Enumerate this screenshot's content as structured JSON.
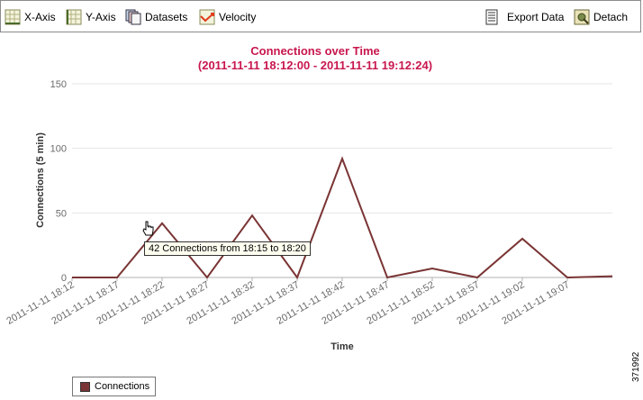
{
  "toolbar": {
    "x_axis_label": "X-Axis",
    "y_axis_label": "Y-Axis",
    "datasets_label": "Datasets",
    "velocity_label": "Velocity",
    "export_label": "Export Data",
    "detach_label": "Detach"
  },
  "tooltip": {
    "text": "42 Connections from 18:15 to 18:20"
  },
  "side_note": "371992",
  "chart_data": {
    "type": "line",
    "title": "Connections over Time",
    "subtitle": "(2011-11-11 18:12:00 - 2011-11-11 19:12:24)",
    "xlabel": "Time",
    "ylabel": "Connections (5 min)",
    "ylim": [
      0,
      150
    ],
    "yticks": [
      0,
      50,
      100,
      150
    ],
    "grid": true,
    "legend_position": "bottom-left",
    "x": [
      "2011-11-11 18:12",
      "2011-11-11 18:17",
      "2011-11-11 18:22",
      "2011-11-11 18:27",
      "2011-11-11 18:32",
      "2011-11-11 18:37",
      "2011-11-11 18:42",
      "2011-11-11 18:47",
      "2011-11-11 18:52",
      "2011-11-11 18:57",
      "2011-11-11 19:02",
      "2011-11-11 19:07"
    ],
    "xticks": [
      "2011-11-11 18:12",
      "2011-11-11 18:17",
      "2011-11-11 18:22",
      "2011-11-11 18:27",
      "2011-11-11 18:32",
      "2011-11-11 18:37",
      "2011-11-11 18:42",
      "2011-11-11 18:47",
      "2011-11-11 18:52",
      "2011-11-11 18:57",
      "2011-11-11 19:02",
      "2011-11-11 19:07"
    ],
    "series": [
      {
        "name": "Connections",
        "color": "#7a3434",
        "values": [
          0,
          0,
          42,
          0,
          48,
          0,
          92,
          0,
          7,
          0,
          30,
          0,
          1
        ]
      }
    ]
  }
}
